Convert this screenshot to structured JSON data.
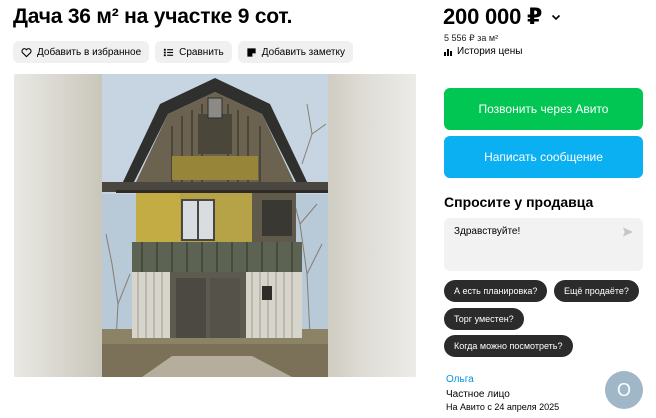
{
  "listing": {
    "title": "Дача 36 м² на участке 9 сот."
  },
  "actions": {
    "favorite": "Добавить в избранное",
    "compare": "Сравнить",
    "note": "Добавить заметку"
  },
  "price": {
    "value": "200 000 ₽",
    "per_meter": "5 556 ₽ за м²",
    "history": "История цены"
  },
  "contact": {
    "call": "Позвонить через Авито",
    "message": "Написать сообщение"
  },
  "ask_seller": {
    "heading": "Спросите у продавца",
    "message_value": "Здравствуйте!",
    "quick_questions": [
      "А есть планировка?",
      "Ещё продаёте?",
      "Торг уместен?",
      "Когда можно посмотреть?"
    ]
  },
  "seller": {
    "name": "Ольга",
    "type": "Частное лицо",
    "since": "На Авито с 24 апреля 2025",
    "avatar_letter": "О"
  },
  "icons": {
    "favorite": "heart-icon",
    "compare": "compare-icon",
    "note": "note-icon",
    "price_dropdown": "chevron-down-icon",
    "history": "chart-icon",
    "send": "send-icon"
  },
  "colors": {
    "call_button": "#02c653",
    "message_button": "#0ab0f2",
    "chip_bg": "#2b2b2b",
    "seller_link": "#0094e6",
    "avatar_bg": "#9fb7c6"
  }
}
